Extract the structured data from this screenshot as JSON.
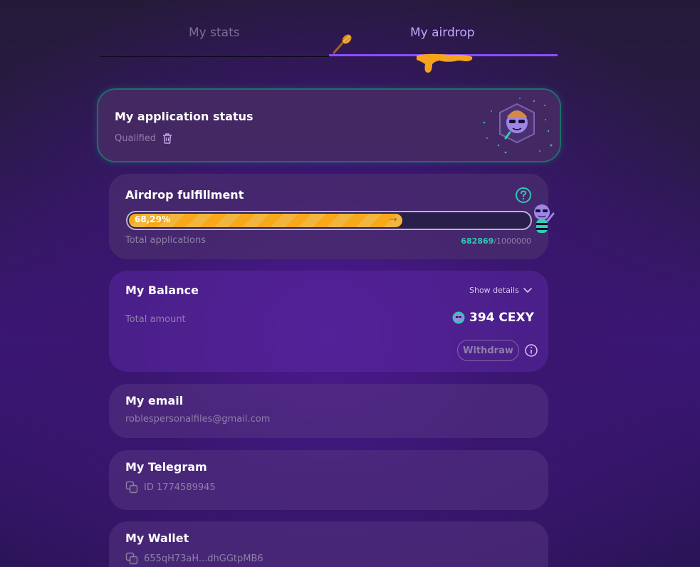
{
  "tabs": {
    "stats_label": "My stats",
    "airdrop_label": "My airdrop",
    "active": "airdrop"
  },
  "status_card": {
    "title": "My application status",
    "status": "Qualified"
  },
  "fulfillment": {
    "title": "Airdrop fulfillment",
    "percent_label": "68,29%",
    "progress": 0.6829,
    "footer_label": "Total applications",
    "count": "682869",
    "total": "/1000000"
  },
  "balance": {
    "title": "My Balance",
    "show_details": "Show details",
    "total_label": "Total amount",
    "amount": "394 CEXY",
    "withdraw_label": "Withdraw"
  },
  "email": {
    "title": "My email",
    "value": "roblespersonalfiles@gmail.com"
  },
  "telegram": {
    "title": "My Telegram",
    "value": "ID 1774589945"
  },
  "wallet": {
    "title": "My Wallet",
    "value": "655qH73aH...dhGGtpMB6"
  },
  "colors": {
    "accent": "#8a4dff",
    "progress": "#f7a81b",
    "teal": "#2ec9b3"
  }
}
